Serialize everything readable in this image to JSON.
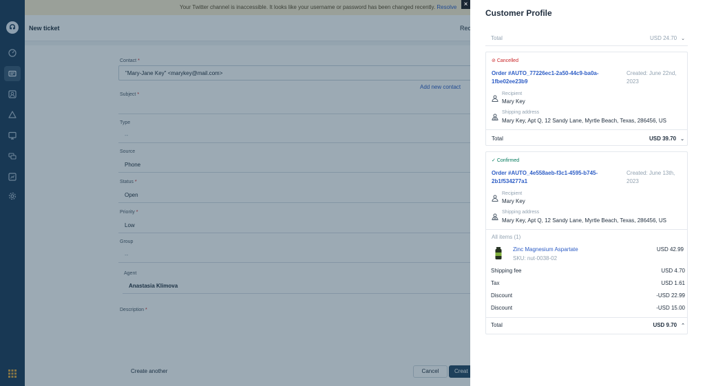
{
  "notice": {
    "text": "Your Twitter channel is inaccessible. It looks like your username or password has been changed recently.",
    "link": "Resolve"
  },
  "header": {
    "title": "New ticket",
    "right_label": "Rec"
  },
  "form": {
    "contact_label": "Contact",
    "contact_value": "\"Mary-Jane Key\" <marykey@mail.com>",
    "add_contact": "Add new contact",
    "subject_label": "Subject",
    "type_label": "Type",
    "type_value": "--",
    "source_label": "Source",
    "source_value": "Phone",
    "status_label": "Status",
    "status_value": "Open",
    "priority_label": "Priority",
    "priority_value": "Low",
    "group_label": "Group",
    "group_value": "--",
    "agent_label": "Agent",
    "agent_value": "Anastasia Klimova",
    "description_label": "Description",
    "required_mark": "*",
    "create_another": "Create another",
    "cancel": "Cancel",
    "create": "Creat"
  },
  "panel": {
    "title": "Customer Profile",
    "close": "×",
    "top_total": {
      "label": "Total",
      "value": "USD 24.70"
    },
    "orders": [
      {
        "status": "Cancelled",
        "order_id": "Order #AUTO_77226ec1-2a50-44c9-ba0a-1fbe02ee23b9",
        "created": "Created: June 22nd, 2023",
        "recipient_label": "Recipient",
        "recipient": "Mary Key",
        "shipping_label": "Shipping address",
        "shipping": "Mary Key, Apt Q, 12 Sandy Lane, Myrtle Beach, Texas, 286456, US",
        "total_label": "Total",
        "total": "USD 39.70"
      },
      {
        "status": "Confirmed",
        "order_id": "Order #AUTO_4e558aeb-f3c1-4595-b745-2b1f534277a1",
        "created": "Created: June 13th, 2023",
        "recipient_label": "Recipient",
        "recipient": "Mary Key",
        "shipping_label": "Shipping address",
        "shipping": "Mary Key, Apt Q, 12 Sandy Lane, Myrtle Beach, Texas, 286456, US",
        "items_label": "All items (1)",
        "item": {
          "name": "Zinc Magnesium Aspartate",
          "sku": "SKU: nut-0038-02",
          "price": "USD 42.99"
        },
        "lines": [
          {
            "label": "Shipping fee",
            "value": "USD 4.70"
          },
          {
            "label": "Tax",
            "value": "USD 1.61"
          },
          {
            "label": "Discount",
            "value": "-USD 22.99"
          },
          {
            "label": "Discount",
            "value": "-USD 15.00"
          }
        ],
        "total_label": "Total",
        "total": "USD 9.70"
      }
    ]
  },
  "colors": {
    "sidebar": "#1d3b5a",
    "overlay": "#12344d",
    "link": "#2c5cc5",
    "cancelled": "#c82124",
    "confirmed": "#00795b"
  }
}
